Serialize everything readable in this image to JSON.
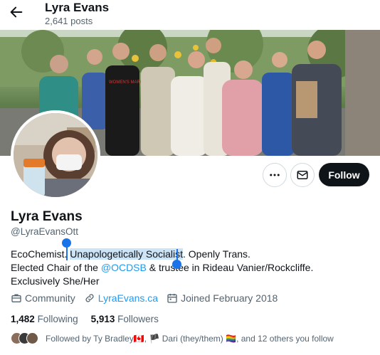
{
  "header": {
    "title": "Lyra Evans",
    "post_count": "2,641 posts"
  },
  "banner": {
    "shirt_print": "WOMEN'S MARCH"
  },
  "profile": {
    "name": "Lyra Evans",
    "handle": "@LyraEvansOtt",
    "follow_label": "Follow"
  },
  "bio": {
    "line1_a": "EcoChemist. ",
    "line1_selected": "Unapologetically Socialist",
    "line1_b": ". Openly Trans.",
    "line2_a": "Elected Chair of the ",
    "line2_link": "@OCDSB",
    "line2_b": " & trustee in Rideau Vanier/Rockcliffe.",
    "line3": "Exclusively She/Her"
  },
  "meta": {
    "category": "Community",
    "website": "LyraEvans.ca",
    "joined": "Joined February 2018"
  },
  "stats": {
    "following_count": "1,482",
    "following_label": "Following",
    "followers_count": "5,913",
    "followers_label": "Followers"
  },
  "followed_by": {
    "prefix": "Followed by Ty Bradley",
    "flag1": "🇨🇦",
    "sep": ", ",
    "flag2": "🏴",
    "name2": " Dari (they/them) ",
    "flag3": "🏳️‍🌈",
    "suffix": ", and 12 others you follow"
  },
  "colors": {
    "accent": "#1d9bf0",
    "selection": "#cde4f7",
    "follow_bg": "#0f1419"
  },
  "icons": [
    "back-arrow-icon",
    "more-icon",
    "mail-icon",
    "briefcase-icon",
    "link-icon",
    "calendar-icon"
  ]
}
